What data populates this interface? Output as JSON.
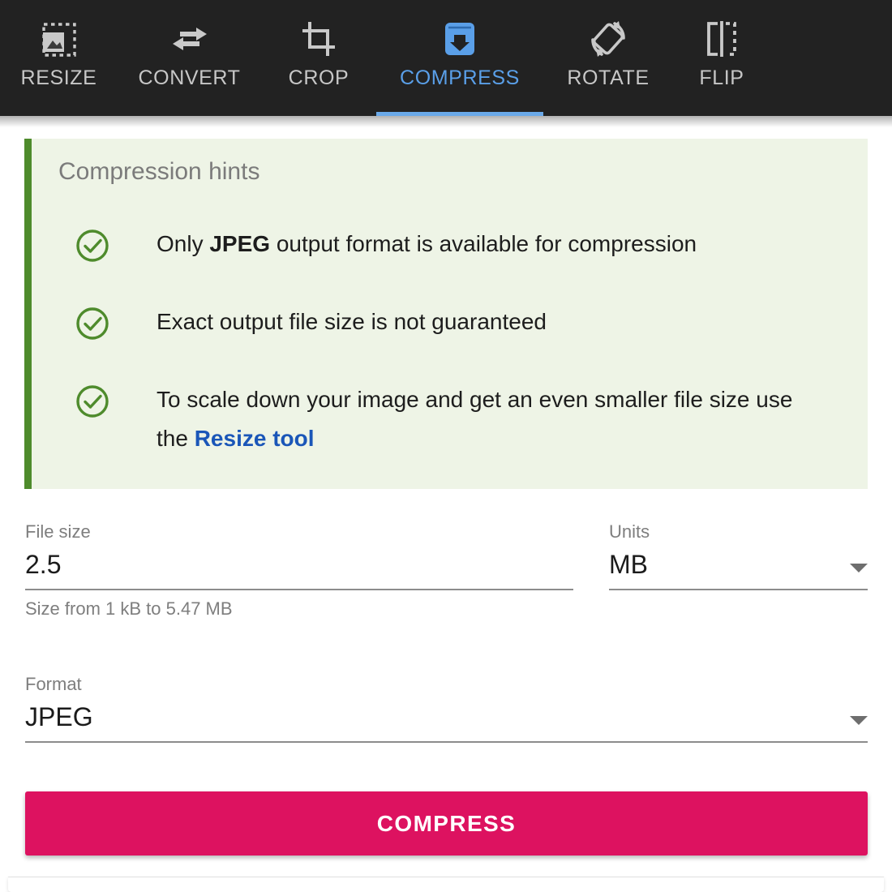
{
  "toolbar": {
    "tabs": [
      {
        "label": "RESIZE",
        "icon": "image-resize-icon",
        "active": false
      },
      {
        "label": "CONVERT",
        "icon": "two-arrows-icon",
        "active": false
      },
      {
        "label": "CROP",
        "icon": "crop-icon",
        "active": false
      },
      {
        "label": "COMPRESS",
        "icon": "compress-down-icon",
        "active": true
      },
      {
        "label": "ROTATE",
        "icon": "rotate-icon",
        "active": false
      },
      {
        "label": "FLIP",
        "icon": "flip-horizontal-icon",
        "active": false
      }
    ],
    "active_color": "#5a9fe8",
    "inactive_color": "#c7c7c7",
    "background": "#222222"
  },
  "hints": {
    "title": "Compression hints",
    "accent_color": "#4e8b2c",
    "background": "#eef4e6",
    "check_icon": "check-circle-icon",
    "items": [
      {
        "pre": "Only ",
        "strong": "JPEG",
        "post": " output format is available for compression",
        "link": "",
        "tail": ""
      },
      {
        "pre": "Exact output file size is not guaranteed",
        "strong": "",
        "post": "",
        "link": "",
        "tail": ""
      },
      {
        "pre": "To scale down your image and get an even smaller file size use the ",
        "strong": "",
        "post": "",
        "link": "Resize tool",
        "tail": ""
      }
    ]
  },
  "form": {
    "file_size": {
      "label": "File size",
      "value": "2.5",
      "placeholder": "2.5",
      "hint": "Size from 1 kB to 5.47 MB"
    },
    "units": {
      "label": "Units",
      "value": "MB",
      "caret": "chevron-down-icon"
    },
    "format": {
      "label": "Format",
      "value": "JPEG",
      "caret": "chevron-down-icon"
    }
  },
  "actions": {
    "compress_label": "COMPRESS",
    "compress_color": "#dd1260"
  }
}
